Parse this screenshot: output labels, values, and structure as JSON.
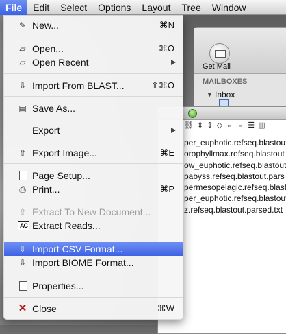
{
  "menubar": {
    "items": [
      "File",
      "Edit",
      "Select",
      "Options",
      "Layout",
      "Tree",
      "Window"
    ],
    "active": "File"
  },
  "mail_window": {
    "get_mail_label": "Get Mail",
    "mailboxes_header": "MAILBOXES",
    "inbox_label": "Inbox"
  },
  "doc_window": {
    "toolbar_icons": "⛓ ⇕ ⇕ ◇ ⇔ ⇔ ☰ ▥",
    "files": [
      "per_euphotic.refseq.blastout",
      "orophyllmax.refseq.blastout",
      "ow_euphotic.refseq.blastout",
      "pabyss.refseq.blastout.pars",
      "permesopelagic.refseq.blastou",
      "per_euphotic.refseq.blastout",
      "z.refseq.blastout.parsed.txt"
    ]
  },
  "file_menu": {
    "new": {
      "label": "New...",
      "shortcut": "⌘N"
    },
    "open": {
      "label": "Open...",
      "shortcut": "⌘O"
    },
    "open_recent": {
      "label": "Open Recent"
    },
    "import_blast": {
      "label": "Import From BLAST...",
      "shortcut": "⇧⌘O"
    },
    "save_as": {
      "label": "Save As..."
    },
    "export": {
      "label": "Export"
    },
    "export_image": {
      "label": "Export Image...",
      "shortcut": "⌘E"
    },
    "page_setup": {
      "label": "Page Setup..."
    },
    "print": {
      "label": "Print...",
      "shortcut": "⌘P"
    },
    "extract_doc": {
      "label": "Extract To New Document..."
    },
    "extract_reads": {
      "label": "Extract Reads..."
    },
    "import_csv": {
      "label": "Import CSV Format..."
    },
    "import_biome": {
      "label": "Import BIOME Format..."
    },
    "properties": {
      "label": "Properties..."
    },
    "close": {
      "label": "Close",
      "shortcut": "⌘W"
    }
  },
  "colors": {
    "highlight": "#4a6ee8",
    "menubar": "#e6e6e6",
    "disabled_text": "#9d9d9d"
  }
}
